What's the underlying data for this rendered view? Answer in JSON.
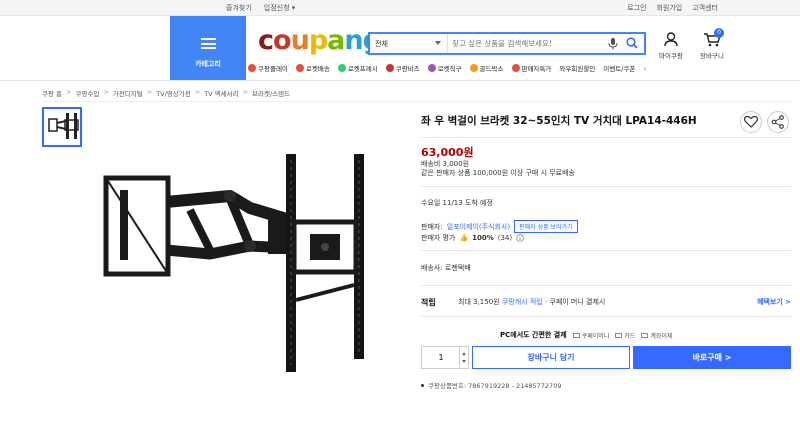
{
  "topbar": {
    "left": [
      "즐겨찾기",
      "입점신청 ▾"
    ],
    "right": [
      "로그인",
      "회원가입",
      "고객센터"
    ]
  },
  "header": {
    "category_label": "카테고리",
    "logo": {
      "letters": [
        "c",
        "o",
        "u",
        "p",
        "a",
        "n",
        "g"
      ],
      "colors": [
        "#8b1a1a",
        "#c0392b",
        "#e67e22",
        "#f2b705",
        "#7ab800",
        "#2a9fd6",
        "#2a9fd6"
      ]
    },
    "search": {
      "scope": "전체",
      "placeholder": "찾고 싶은 상품을 검색해보세요!"
    },
    "mycoupang_label": "마이쿠팡",
    "cart_label": "장바구니",
    "cart_count": "0"
  },
  "service_nav": [
    {
      "label": "쿠팡플레이",
      "color": "#e74c3c"
    },
    {
      "label": "로켓배송",
      "color": "#e74c3c"
    },
    {
      "label": "로켓프레시",
      "color": "#2ecc71"
    },
    {
      "label": "쿠팡비즈",
      "color": "#c0392b"
    },
    {
      "label": "로켓직구",
      "color": "#9b59b6"
    },
    {
      "label": "골드박스",
      "color": "#f39c12"
    },
    {
      "label": "판매자특가",
      "color": "#e74c3c"
    },
    {
      "label": "와우회원할인",
      "color": ""
    },
    {
      "label": "이벤트/쿠폰",
      "color": ""
    }
  ],
  "breadcrumb": [
    "쿠팡 홈",
    "쿠팡수입",
    "가전디지털",
    "TV/영상가전",
    "TV 액세서리",
    "브라켓/스탠드"
  ],
  "product": {
    "title": "좌 우 벽걸이 브라켓 32~55인치 TV 거치대 LPA14-446H",
    "price": "63,000원",
    "shipping_fee": "배송비 3,000원",
    "free_shipping": "같은 판매자 상품 100,000원 이상 구매 시 무료배송",
    "arrival": "수요일 11/13 도착 예정",
    "seller_label": "판매자:",
    "seller_name": "일포이제이(주식회사)",
    "seller_more": "판매자 상품 보러가기",
    "rating_label": "판매자 평가",
    "rating_value": "100%",
    "rating_count": "(34)",
    "delivery": "배송사: 로젠택배",
    "reward_label": "적립",
    "reward_prefix": "최대 3,150원",
    "reward_link": "쿠팡캐시 적립",
    "reward_suffix": "· 쿠페이 머니 결제시",
    "benefit_link": "혜택보기 >",
    "pay_title": "PC에서도 간편한 결제",
    "pay_options": [
      "쿠페이머니",
      "카드",
      "계좌이체"
    ],
    "quantity": "1",
    "cart_button": "장바구니 담기",
    "buy_button": "바로구매 >",
    "product_code": "쿠팡상품번호: 7867919228 - 21485772709"
  }
}
